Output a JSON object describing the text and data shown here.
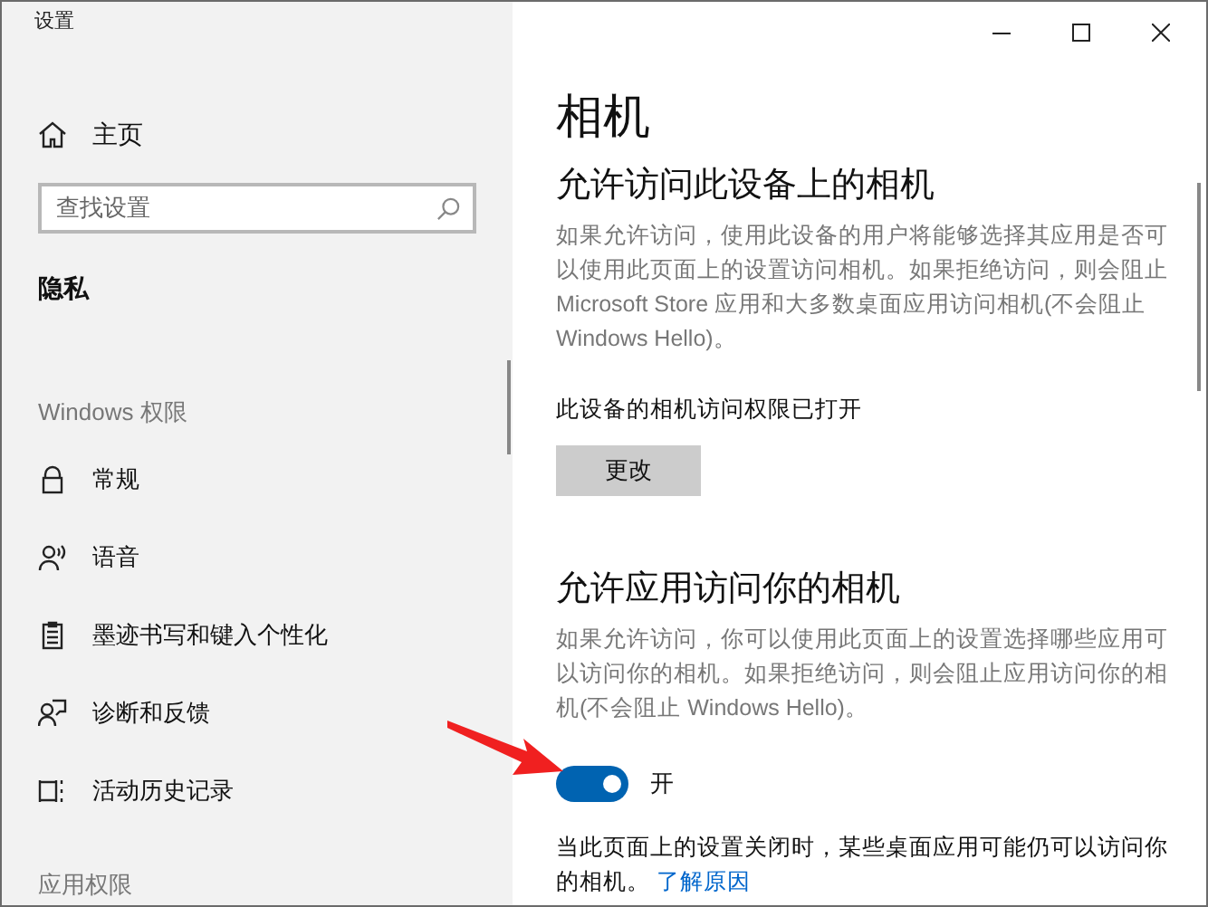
{
  "window": {
    "title": "设置"
  },
  "sidebar": {
    "home": "主页",
    "search": {
      "placeholder": "查找设置"
    },
    "section": "隐私",
    "group": "Windows 权限",
    "items": [
      {
        "kind": "lock",
        "label": "常规"
      },
      {
        "kind": "speech",
        "label": "语音"
      },
      {
        "kind": "clipboard",
        "label": "墨迹书写和键入个性化"
      },
      {
        "kind": "feedback",
        "label": "诊断和反馈"
      },
      {
        "kind": "history",
        "label": "活动历史记录"
      }
    ],
    "group_2": "应用权限"
  },
  "content": {
    "title": "相机",
    "device_heading": "允许访问此设备上的相机",
    "device_text": "如果允许访问，使用此设备的用户将能够选择其应用是否可以使用此页面上的设置访问相机。如果拒绝访问，则会阻止 Microsoft Store 应用和大多数桌面应用访问相机(不会阻止 Windows Hello)。",
    "device_status": "此设备的相机访问权限已打开",
    "change_button": "更改",
    "apps_heading": "允许应用访问你的相机",
    "apps_text": "如果允许访问，你可以使用此页面上的设置选择哪些应用可以访问你的相机。如果拒绝访问，则会阻止应用访问你的相机(不会阻止 Windows Hello)。",
    "toggle": {
      "on": true,
      "label": "开"
    },
    "note": "当此页面上的设置关闭时，某些桌面应用可能仍可以访问你的相机。",
    "link": "了解原因"
  }
}
